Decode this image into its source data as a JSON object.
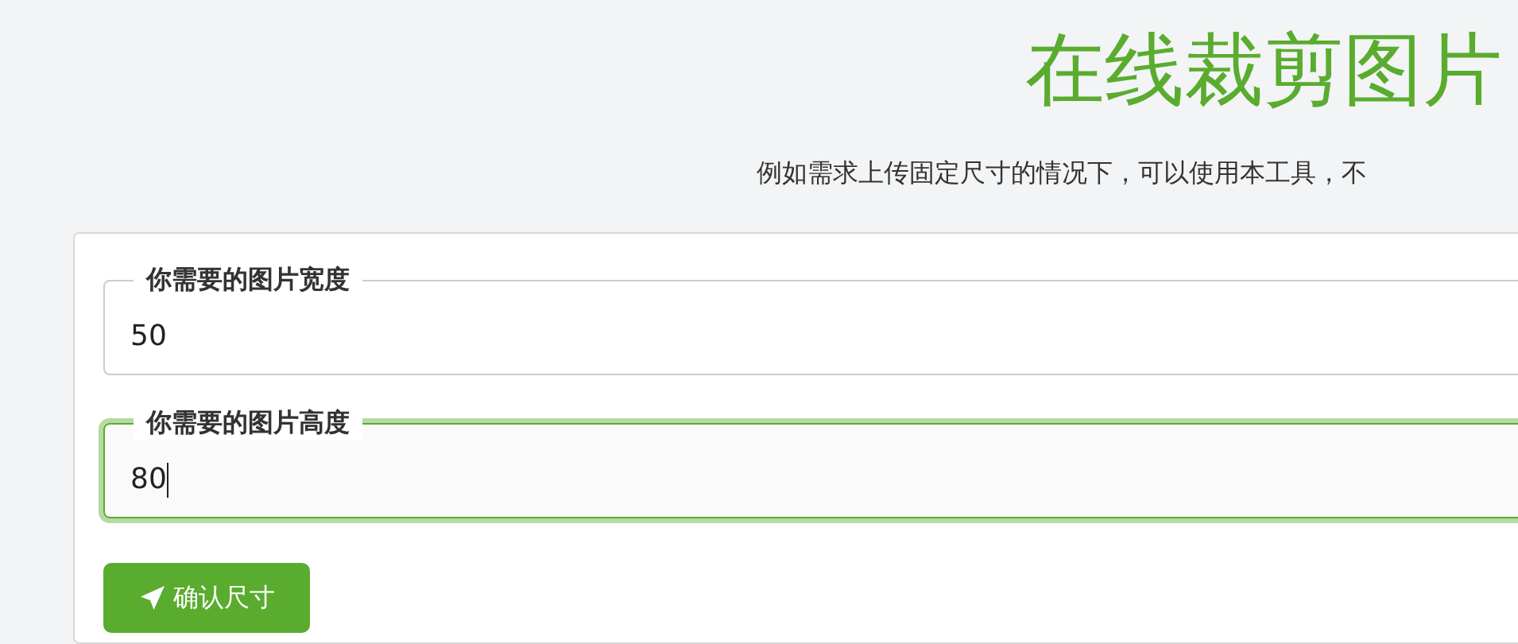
{
  "title": "在线裁剪图片",
  "subtitle": "例如需求上传固定尺寸的情况下，可以使用本工具，不",
  "fields": [
    {
      "label": "你需要的图片宽度",
      "value": "50",
      "focused": false
    },
    {
      "label": "你需要的图片高度",
      "value": "80",
      "focused": true
    }
  ],
  "confirm_button": {
    "label": "确认尺寸"
  }
}
